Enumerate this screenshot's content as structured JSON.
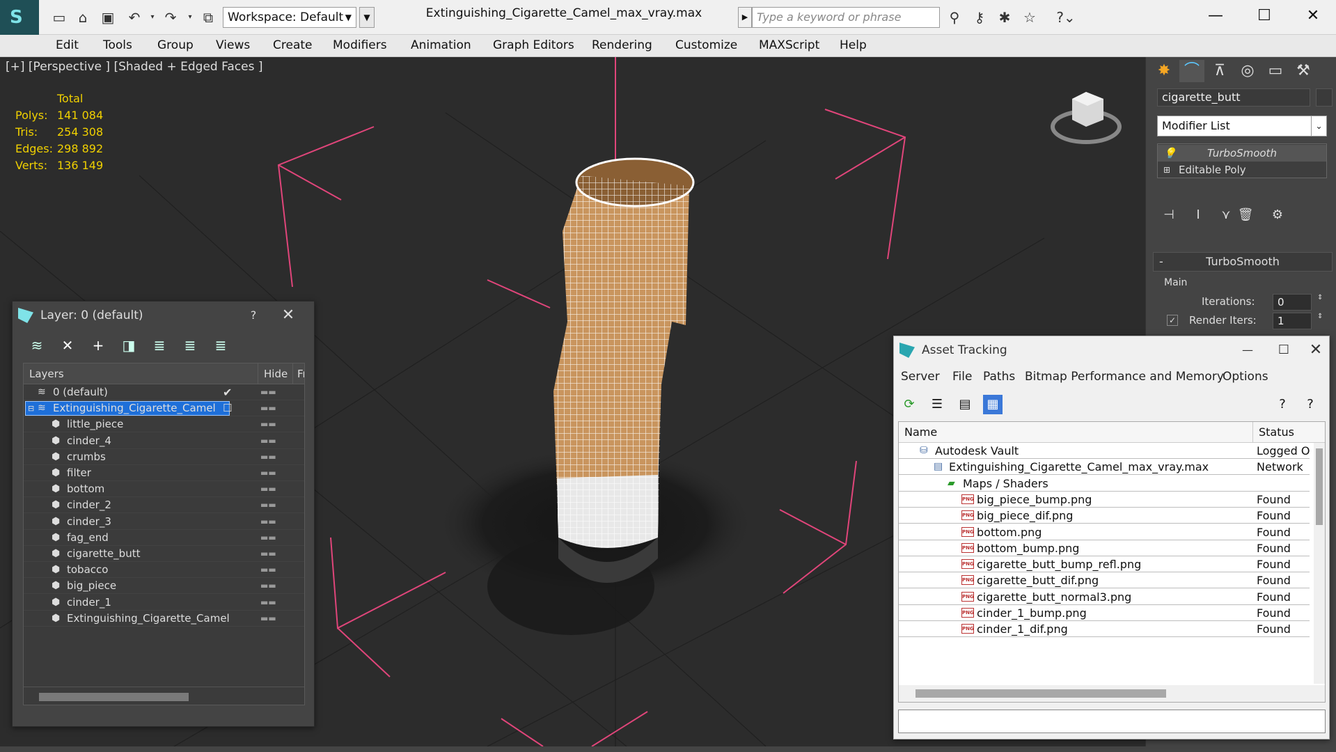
{
  "window": {
    "title": "Extinguishing_Cigarette_Camel_max_vray.max",
    "workspace": "Workspace: Default",
    "search_placeholder": "Type a keyword or phrase"
  },
  "menu": [
    "Edit",
    "Tools",
    "Group",
    "Views",
    "Create",
    "Modifiers",
    "Animation",
    "Graph Editors",
    "Rendering",
    "Customize",
    "MAXScript",
    "Help"
  ],
  "viewport": {
    "label": "[+] [Perspective ] [Shaded + Edged Faces ]",
    "stats_header": "Total",
    "stats": [
      {
        "label": "Polys:",
        "value": "141 084"
      },
      {
        "label": "Tris:",
        "value": "254 308"
      },
      {
        "label": "Edges:",
        "value": "298 892"
      },
      {
        "label": "Verts:",
        "value": "136 149"
      }
    ]
  },
  "command_panel": {
    "object_name": "cigarette_butt",
    "modifier_list": "Modifier List",
    "stack": [
      "TurboSmooth",
      "Editable Poly"
    ],
    "rollout_title": "TurboSmooth",
    "group": "Main",
    "iterations_label": "Iterations:",
    "iterations_value": "0",
    "render_iters_label": "Render Iters:",
    "render_iters_value": "1"
  },
  "layer_window": {
    "title": "Layer: 0 (default)",
    "help": "?",
    "columns": {
      "layers": "Layers",
      "hide": "Hide",
      "freeze": "Fr"
    },
    "rows": [
      {
        "name": "0 (default)",
        "level": 0
      },
      {
        "name": "Extinguishing_Cigarette_Camel",
        "level": 0,
        "selected": true
      },
      {
        "name": "little_piece",
        "level": 1
      },
      {
        "name": "cinder_4",
        "level": 1
      },
      {
        "name": "crumbs",
        "level": 1
      },
      {
        "name": "filter",
        "level": 1
      },
      {
        "name": "bottom",
        "level": 1
      },
      {
        "name": "cinder_2",
        "level": 1
      },
      {
        "name": "cinder_3",
        "level": 1
      },
      {
        "name": "fag_end",
        "level": 1
      },
      {
        "name": "cigarette_butt",
        "level": 1
      },
      {
        "name": "tobacco",
        "level": 1
      },
      {
        "name": "big_piece",
        "level": 1
      },
      {
        "name": "cinder_1",
        "level": 1
      },
      {
        "name": "Extinguishing_Cigarette_Camel",
        "level": 1
      }
    ]
  },
  "asset_window": {
    "title": "Asset Tracking",
    "menu": [
      "Server",
      "File",
      "Paths",
      "Bitmap Performance and Memory",
      "Options"
    ],
    "columns": {
      "name": "Name",
      "status": "Status"
    },
    "rows": [
      {
        "name": "Autodesk Vault",
        "status": "Logged O",
        "indent": 1,
        "icon": "vault"
      },
      {
        "name": "Extinguishing_Cigarette_Camel_max_vray.max",
        "status": "Network",
        "indent": 2,
        "icon": "max"
      },
      {
        "name": "Maps / Shaders",
        "status": "",
        "indent": 3,
        "icon": "maps"
      },
      {
        "name": "big_piece_bump.png",
        "status": "Found",
        "indent": 4,
        "icon": "png"
      },
      {
        "name": "big_piece_dif.png",
        "status": "Found",
        "indent": 4,
        "icon": "png"
      },
      {
        "name": "bottom.png",
        "status": "Found",
        "indent": 4,
        "icon": "png"
      },
      {
        "name": "bottom_bump.png",
        "status": "Found",
        "indent": 4,
        "icon": "png"
      },
      {
        "name": "cigarette_butt_bump_refl.png",
        "status": "Found",
        "indent": 4,
        "icon": "png"
      },
      {
        "name": "cigarette_butt_dif.png",
        "status": "Found",
        "indent": 4,
        "icon": "png"
      },
      {
        "name": "cigarette_butt_normal3.png",
        "status": "Found",
        "indent": 4,
        "icon": "png"
      },
      {
        "name": "cinder_1_bump.png",
        "status": "Found",
        "indent": 4,
        "icon": "png"
      },
      {
        "name": "cinder_1_dif.png",
        "status": "Found",
        "indent": 4,
        "icon": "png"
      }
    ]
  },
  "colors": {
    "stats_yellow": "#f0d000",
    "selection_blue": "#1e6fd9",
    "grid_pink": "#e0457a",
    "viewport_bg": "#2c2c2c"
  }
}
